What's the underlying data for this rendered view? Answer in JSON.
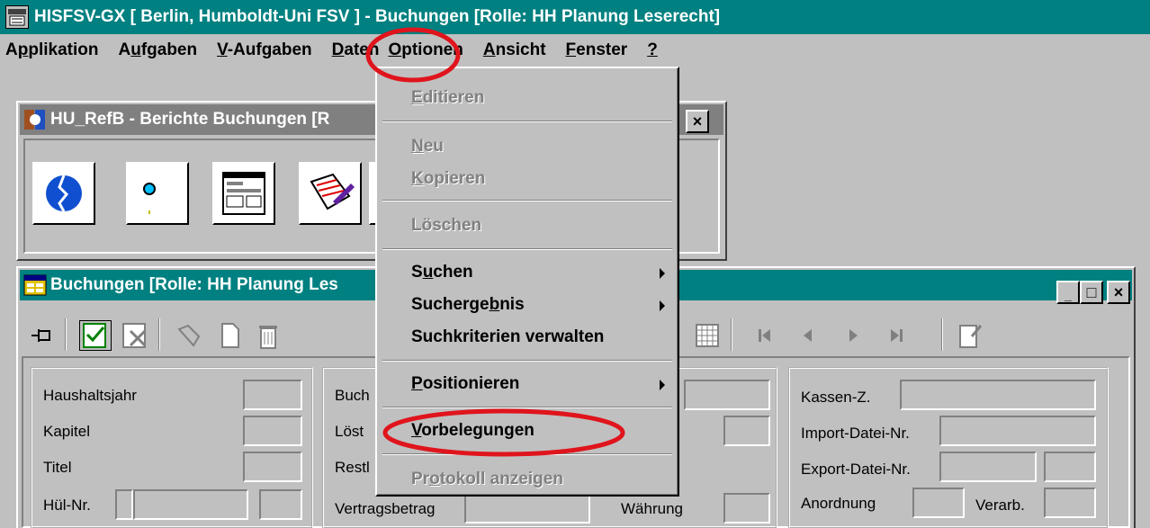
{
  "app": {
    "title": "HISFSV-GX  [ Berlin, Humboldt-Uni FSV ] - Buchungen [Rolle: HH Planung Leserecht]"
  },
  "menubar": {
    "items": [
      {
        "label": "Applikation"
      },
      {
        "label": "Aufgaben"
      },
      {
        "label": "V-Aufgaben"
      },
      {
        "label": "Daten"
      },
      {
        "label": "Optionen"
      },
      {
        "label": "Ansicht"
      },
      {
        "label": "Fenster"
      },
      {
        "label": "?"
      }
    ]
  },
  "dropdown": {
    "items": [
      {
        "label": "Editieren",
        "enabled": false
      },
      {
        "label": "Neu",
        "enabled": false
      },
      {
        "label": "Kopieren",
        "enabled": false
      },
      {
        "label": "Löschen",
        "enabled": false
      },
      {
        "label": "Suchen",
        "enabled": true,
        "submenu": true
      },
      {
        "label": "Suchergebnis",
        "enabled": true,
        "submenu": true
      },
      {
        "label": "Suchkriterien verwalten",
        "enabled": true
      },
      {
        "label": "Positionieren",
        "enabled": true,
        "submenu": true
      },
      {
        "label": "Vorbelegungen",
        "enabled": true
      },
      {
        "label": "Protokoll anzeigen",
        "enabled": false
      }
    ]
  },
  "reports_window": {
    "title": "HU_RefB - Berichte Buchungen [R",
    "close_label": "×",
    "buttons": [
      "report-globe-icon",
      "report-dot-icon",
      "report-form-icon",
      "report-pen-icon",
      "report-doc-icon"
    ]
  },
  "bookings_window": {
    "title": "Buchungen [Rolle: HH Planung Les",
    "minimize_label": "_",
    "maximize_label": "□",
    "close_label": "×",
    "toolbar_icons": [
      "pin-icon",
      "edit-check-icon",
      "delete-record-icon",
      "tools-icon",
      "new-doc-icon",
      "trash-icon",
      "grid-icon",
      "first-record-icon",
      "prev-record-icon",
      "next-record-icon",
      "last-record-icon",
      "note-icon"
    ],
    "group1": {
      "haushaltsjahr": "Haushaltsjahr",
      "kapitel": "Kapitel",
      "titel": "Titel",
      "huel_nr": "Hül-Nr."
    },
    "group2": {
      "buch": "Buch",
      "loest": "Löst",
      "restl": "Restl",
      "vertragsbetrag": "Vertragsbetrag",
      "waehrung": "Währung"
    },
    "group3": {
      "kassen_z": "Kassen-Z.",
      "import_datei": "Import-Datei-Nr.",
      "export_datei": "Export-Datei-Nr.",
      "anordnung": "Anordnung",
      "verarb": "Verarb."
    }
  },
  "colors": {
    "titlebar": "#008080",
    "face": "#c0c0c0",
    "highlight_circle": "#e0141c"
  }
}
